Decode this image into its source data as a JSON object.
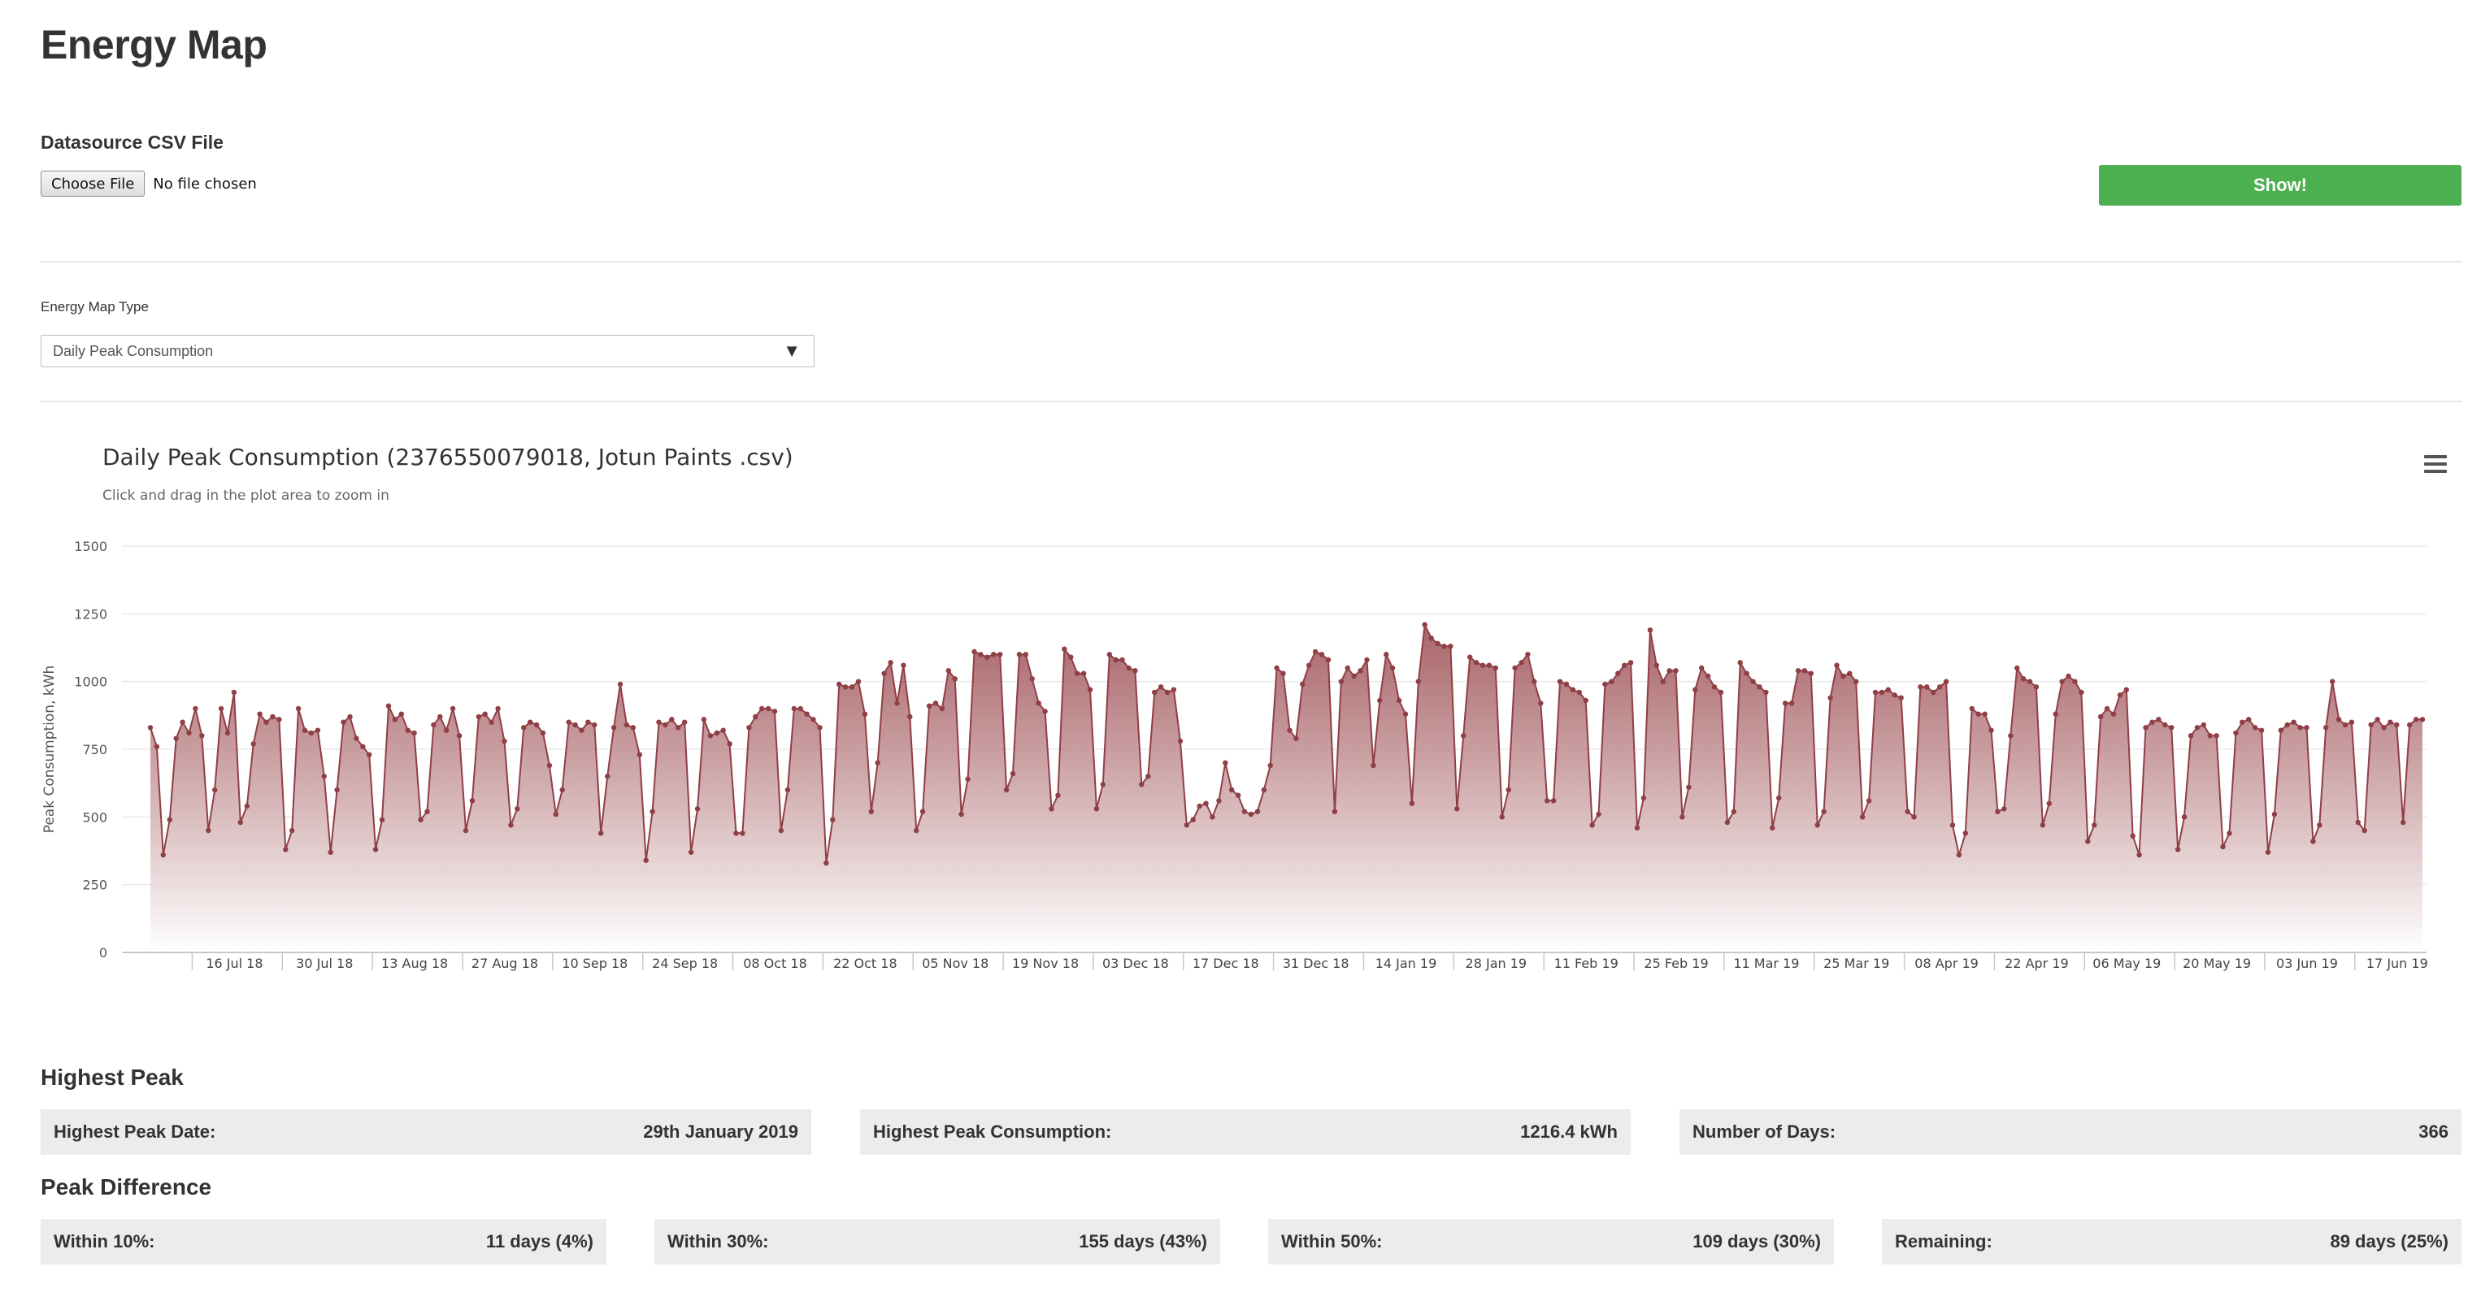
{
  "page": {
    "title": "Energy Map"
  },
  "datasource": {
    "label": "Datasource CSV File",
    "choose_label": "Choose File",
    "status": "No file chosen"
  },
  "show_button": "Show!",
  "map_type": {
    "label": "Energy Map Type",
    "selected": "Daily Peak Consumption"
  },
  "chart_header": {
    "title": "Daily Peak Consumption (2376550079018, Jotun Paints .csv)",
    "subtitle": "Click and drag in the plot area to zoom in"
  },
  "chart_data": {
    "type": "area",
    "title": "Daily Peak Consumption (2376550079018, Jotun Paints .csv)",
    "ylabel": "Peak Consumption, kWh",
    "ylim": [
      0,
      1500
    ],
    "yticks": [
      0,
      250,
      500,
      750,
      1000,
      1250,
      1500
    ],
    "x_start": "2018-07-09",
    "xlim": [
      "2018-07-09",
      "2019-07-09"
    ],
    "xtick_labels": [
      "16 Jul 18",
      "30 Jul 18",
      "13 Aug 18",
      "27 Aug 18",
      "10 Sep 18",
      "24 Sep 18",
      "08 Oct 18",
      "22 Oct 18",
      "05 Nov 18",
      "19 Nov 18",
      "03 Dec 18",
      "17 Dec 18",
      "31 Dec 18",
      "14 Jan 19",
      "28 Jan 19",
      "11 Feb 19",
      "25 Feb 19",
      "11 Mar 19",
      "25 Mar 19",
      "08 Apr 19",
      "22 Apr 19",
      "06 May 19",
      "20 May 19",
      "03 Jun 19",
      "17 Jun 19"
    ],
    "series": [
      {
        "weeks": [
          [
            830,
            760,
            360,
            490,
            790,
            850,
            810
          ],
          [
            900,
            800,
            450,
            600,
            900,
            810,
            960
          ],
          [
            480,
            540,
            770,
            880,
            850,
            870,
            860
          ],
          [
            380,
            450,
            900,
            820,
            810,
            820,
            650
          ],
          [
            370,
            600,
            850,
            870,
            790,
            760,
            730
          ],
          [
            380,
            490,
            910,
            860,
            880,
            820,
            810
          ],
          [
            490,
            520,
            840,
            870,
            820,
            900,
            800
          ],
          [
            450,
            560,
            870,
            880,
            850,
            900,
            780
          ],
          [
            470,
            530,
            830,
            850,
            840,
            810,
            690
          ],
          [
            510,
            600,
            850,
            840,
            820,
            850,
            840
          ],
          [
            440,
            650,
            830,
            990,
            840,
            830,
            730
          ],
          [
            340,
            520,
            850,
            840,
            860,
            830,
            850
          ],
          [
            370,
            530,
            860,
            800,
            810,
            820,
            770
          ],
          [
            440,
            440,
            830,
            870,
            900,
            900,
            890
          ],
          [
            450,
            600,
            900,
            900,
            880,
            860,
            830
          ],
          [
            330,
            490,
            990,
            980,
            980,
            1000,
            880
          ],
          [
            520,
            700,
            1030,
            1070,
            920,
            1060,
            870
          ],
          [
            450,
            520,
            910,
            920,
            900,
            1040,
            1010
          ],
          [
            510,
            640,
            1110,
            1100,
            1090,
            1100,
            1100
          ],
          [
            600,
            660,
            1100,
            1100,
            1010,
            920,
            890
          ],
          [
            530,
            580,
            1120,
            1090,
            1030,
            1030,
            970
          ],
          [
            530,
            620,
            1100,
            1080,
            1080,
            1050,
            1040
          ],
          [
            620,
            650,
            960,
            980,
            960,
            970,
            780
          ],
          [
            470,
            490,
            540,
            550,
            500,
            560,
            700
          ],
          [
            600,
            580,
            520,
            510,
            520,
            600,
            690
          ],
          [
            1050,
            1030,
            820,
            790,
            990,
            1060,
            1110
          ],
          [
            1100,
            1080,
            520,
            1000,
            1050,
            1020,
            1040
          ],
          [
            1080,
            690,
            930,
            1100,
            1050,
            930,
            880
          ],
          [
            550,
            1000,
            1210,
            1160,
            1140,
            1130,
            1130
          ],
          [
            530,
            800,
            1090,
            1070,
            1060,
            1060,
            1050
          ],
          [
            500,
            600,
            1050,
            1070,
            1100,
            1000,
            920
          ],
          [
            560,
            560,
            1000,
            990,
            970,
            960,
            930
          ],
          [
            470,
            510,
            990,
            1000,
            1030,
            1060,
            1070
          ],
          [
            460,
            570,
            1190,
            1060,
            1000,
            1040,
            1040
          ],
          [
            500,
            610,
            970,
            1050,
            1020,
            980,
            960
          ],
          [
            480,
            520,
            1070,
            1030,
            1000,
            980,
            960
          ],
          [
            460,
            570,
            920,
            920,
            1040,
            1040,
            1030
          ],
          [
            470,
            520,
            940,
            1060,
            1020,
            1030,
            1000
          ],
          [
            500,
            560,
            960,
            960,
            970,
            950,
            940
          ],
          [
            520,
            500,
            980,
            980,
            960,
            980,
            1000
          ],
          [
            470,
            360,
            440,
            900,
            880,
            880,
            820
          ],
          [
            520,
            530,
            800,
            1050,
            1010,
            1000,
            980
          ],
          [
            470,
            550,
            880,
            1000,
            1020,
            1000,
            960
          ],
          [
            410,
            470,
            870,
            900,
            880,
            950,
            970
          ],
          [
            430,
            360,
            830,
            850,
            860,
            840,
            830
          ],
          [
            380,
            500,
            800,
            830,
            840,
            800,
            800
          ],
          [
            390,
            440,
            810,
            850,
            860,
            830,
            820
          ],
          [
            370,
            510,
            820,
            840,
            850,
            830,
            830
          ],
          [
            410,
            470,
            830,
            1000,
            860,
            840,
            850
          ],
          [
            480,
            450,
            840,
            860,
            830,
            850,
            840
          ],
          [
            480,
            840,
            860,
            860
          ]
        ]
      }
    ]
  },
  "highest_peak": {
    "title": "Highest Peak",
    "date_label": "Highest Peak Date:",
    "date_value": "29th January 2019",
    "consumption_label": "Highest Peak Consumption:",
    "consumption_value": "1216.4 kWh",
    "days_label": "Number of Days:",
    "days_value": "366"
  },
  "peak_difference": {
    "title": "Peak Difference",
    "items": [
      {
        "label": "Within 10%:",
        "value": "11 days (4%)"
      },
      {
        "label": "Within 30%:",
        "value": "155 days (43%)"
      },
      {
        "label": "Within 50%:",
        "value": "109 days (30%)"
      },
      {
        "label": "Remaining:",
        "value": "89 days (25%)"
      }
    ]
  }
}
